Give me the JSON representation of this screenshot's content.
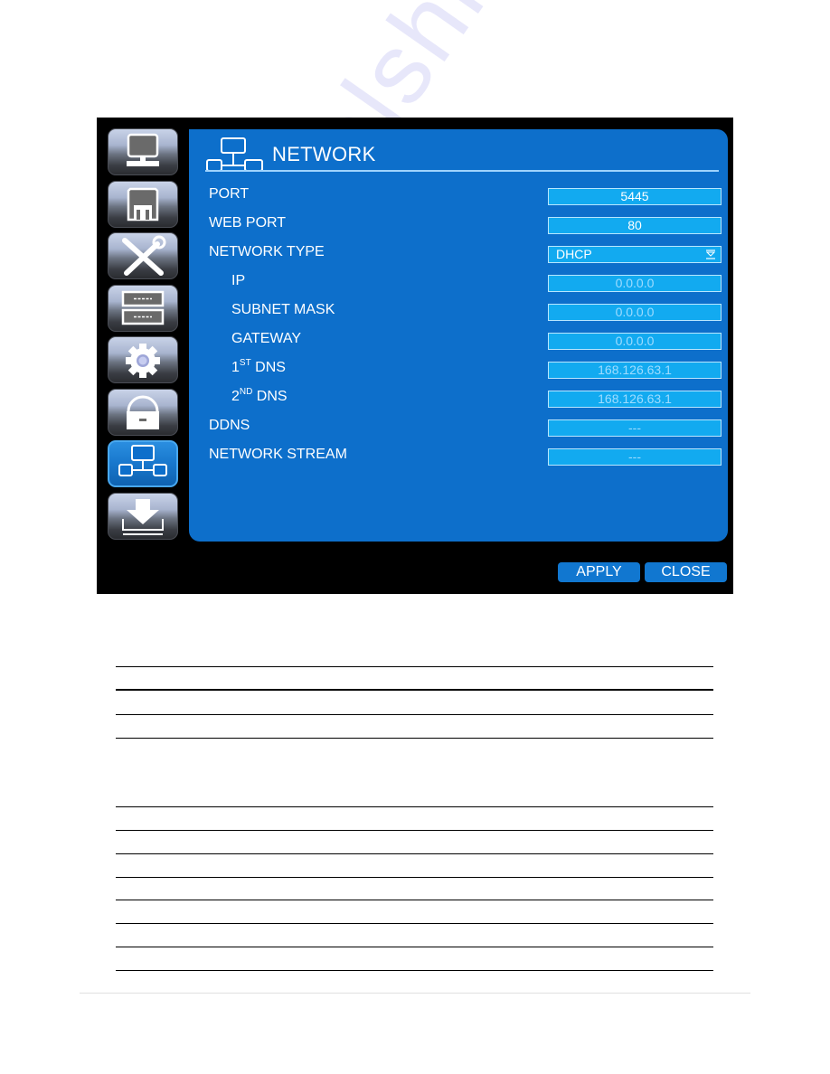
{
  "window": {
    "title": "NETWORK",
    "title_icon": "network-icon"
  },
  "sidebar": {
    "items": [
      {
        "name": "display",
        "icon": "monitor-icon",
        "active": false
      },
      {
        "name": "record",
        "icon": "floppy-disk-icon",
        "active": false
      },
      {
        "name": "tools",
        "icon": "wrench-screwdriver-icon",
        "active": false
      },
      {
        "name": "device",
        "icon": "hdd-list-icon",
        "active": false
      },
      {
        "name": "system",
        "icon": "gear-icon",
        "active": false
      },
      {
        "name": "security",
        "icon": "lock-icon",
        "active": false
      },
      {
        "name": "network",
        "icon": "network-icon",
        "active": true
      },
      {
        "name": "backup",
        "icon": "download-icon",
        "active": false
      }
    ]
  },
  "settings": [
    {
      "label": "PORT",
      "value": "5445",
      "indent": 1,
      "type": "field"
    },
    {
      "label": "WEB PORT",
      "value": "80",
      "indent": 1,
      "type": "field"
    },
    {
      "label": "NETWORK TYPE",
      "value": "DHCP",
      "indent": 1,
      "type": "select"
    },
    {
      "label": "IP",
      "value": "0.0.0.0",
      "indent": 2,
      "type": "field",
      "dim": true
    },
    {
      "label": "SUBNET MASK",
      "value": "0.0.0.0",
      "indent": 2,
      "type": "field",
      "dim": true
    },
    {
      "label": "GATEWAY",
      "value": "0.0.0.0",
      "indent": 2,
      "type": "field",
      "dim": true
    },
    {
      "label_main": "1",
      "label_sup": "ST",
      "label_rest": " DNS",
      "value": "168.126.63.1",
      "indent": 2,
      "type": "field",
      "dim": true
    },
    {
      "label_main": "2",
      "label_sup": "ND",
      "label_rest": " DNS",
      "value": "168.126.63.1",
      "indent": 2,
      "type": "field",
      "dim": true
    },
    {
      "label": "DDNS",
      "value": "---",
      "indent": 1,
      "type": "field",
      "dim": true
    },
    {
      "label": "NETWORK STREAM",
      "value": "---",
      "indent": 1,
      "type": "field",
      "dim": true
    }
  ],
  "buttons": {
    "apply": "APPLY",
    "close": "CLOSE"
  },
  "watermark": "manualshive.com",
  "colors": {
    "panel": "#0d6fcb",
    "field": "#12aaf0",
    "button": "#1177d0",
    "screen_bg": "#000000"
  }
}
